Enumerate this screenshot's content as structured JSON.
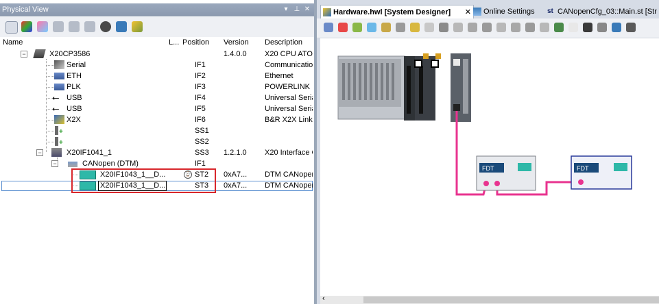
{
  "physical_view": {
    "title": "Physical View",
    "pin_icon": "pin-icon",
    "close_icon": "close-icon",
    "toolbar_icons": [
      "open-icon",
      "color-icon",
      "module-icon",
      "module2-icon",
      "module3-icon",
      "module4-icon",
      "search-icon",
      "network-icon",
      "pencil-icon"
    ],
    "columns": {
      "name": "Name",
      "l": "L...",
      "position": "Position",
      "version": "Version",
      "description": "Description"
    },
    "rows": [
      {
        "name": "X20CP3586",
        "position": "",
        "version": "1.4.0.0",
        "description": "X20 CPU ATO"
      },
      {
        "name": "Serial",
        "position": "IF1",
        "version": "",
        "description": "Communicatior"
      },
      {
        "name": "ETH",
        "position": "IF2",
        "version": "",
        "description": "Ethernet"
      },
      {
        "name": "PLK",
        "position": "IF3",
        "version": "",
        "description": "POWERLINK"
      },
      {
        "name": "USB",
        "position": "IF4",
        "version": "",
        "description": "Universal Seria"
      },
      {
        "name": "USB",
        "position": "IF5",
        "version": "",
        "description": "Universal Seria"
      },
      {
        "name": "X2X",
        "position": "IF6",
        "version": "",
        "description": "B&R X2X Link"
      },
      {
        "name": "",
        "position": "SS1",
        "version": "",
        "description": ""
      },
      {
        "name": "",
        "position": "SS2",
        "version": "",
        "description": ""
      },
      {
        "name": "X20IF1041_1",
        "position": "SS3",
        "version": "1.2.1.0",
        "description": "X20 Interface C"
      },
      {
        "name": "CANopen (DTM)",
        "position": "IF1",
        "version": "",
        "description": ""
      },
      {
        "name": "X20IF1043_1__D...",
        "position": "ST2",
        "version": "0xA7...",
        "description": "DTM CANoper"
      },
      {
        "name": "X20IF1043_1__D...",
        "position": "ST3",
        "version": "0xA7...",
        "description": "DTM CANoper"
      }
    ]
  },
  "editor": {
    "tabs": [
      {
        "label": "Hardware.hwl [System Designer]",
        "icon": "hardware-icon"
      },
      {
        "label": "Online Settings",
        "icon": "monitor-icon"
      },
      {
        "label": "CANopenCfg_03::Main.st [Str",
        "icon": "st-icon"
      }
    ],
    "close_icon": "close-icon",
    "fdt_label_1": "FDT",
    "fdt_label_2": "FDT",
    "colors": {
      "wire": "#e8338f",
      "accent": "#2a3a9a"
    }
  }
}
